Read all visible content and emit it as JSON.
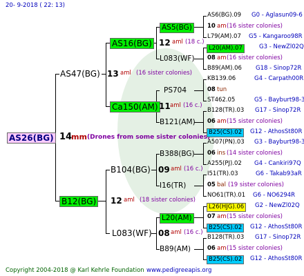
{
  "date_line": "20-  9-2018 ( 22: 13)",
  "copyright": "Copyright 2004-2018 @ Karl Kehrle Foundation",
  "website": "www.pedigreeapis.org",
  "colors": {
    "green_bg": "#00ee00",
    "yellow_bg": "#ffff00",
    "cyan_bg": "#00ccff",
    "pink_bg": "#ffccff",
    "line": "#000000"
  },
  "root": {
    "label": "AS26(BG)",
    "num": "14",
    "unit": "mm",
    "note": "(Drones from some sister colonies)"
  },
  "gen1": [
    {
      "label": "AS47(BG)",
      "num": "13",
      "unit": "aml",
      "note": "(16 sister colonies)"
    },
    {
      "label": "B12(BG)",
      "num": "12",
      "unit": "aml",
      "note": "(18 sister colonies)"
    }
  ],
  "gen2": [
    {
      "label": "AS16(BG)",
      "num": "12",
      "unit": "aml",
      "note": "(18 c.)"
    },
    {
      "label": "Ca150(AM)",
      "num": "11",
      "unit": "aml",
      "note": "(16 c.)"
    },
    {
      "label": "B104(BG)",
      "num": "09",
      "unit": "aml",
      "note": "(16 c.)"
    },
    {
      "label": "L083(WF)",
      "num": "08",
      "unit": "aml",
      "note": "(16 c.)"
    }
  ],
  "gen3": [
    "AS5(BG)",
    "L083(WF)",
    "PS704",
    "B121(AM)",
    "B388(BG)",
    "I16(TR)",
    "L20(AM)",
    "B89(AM)"
  ],
  "gen4": [
    {
      "parent": "AS6(BG).09",
      "g": "G0",
      "origin": "Aglasun09-6",
      "num": "10",
      "unit": "am",
      "note": "(16 sister colonies)",
      "mother": "L79(AM).07",
      "mg": "G5",
      "morigin": "Kangaroo98R"
    },
    {
      "parent": "L20(AM).07",
      "g": "G3",
      "origin": "NewZl02Q",
      "num": "08",
      "unit": "am",
      "note": "(16 sister colonies)",
      "mother": "B89(AM).06",
      "mg": "G18",
      "morigin": "Sinop72R"
    },
    {
      "parent": "KB139.06",
      "g": "G4",
      "origin": "Carpath00R",
      "num": "08",
      "unit": "tun",
      "note": "",
      "mother": "ST462.05",
      "mg": "G5",
      "morigin": "Bayburt98-3"
    },
    {
      "parent": "B128(TR).03",
      "g": "G17",
      "origin": "Sinop72R",
      "num": "06",
      "unit": "am",
      "note": "(15 sister colonies)",
      "mother": "B25(CS).02",
      "mg": "G12",
      "morigin": "AthosSt80R"
    },
    {
      "parent": "A507(PN).03",
      "g": "G3",
      "origin": "Bayburt98-3",
      "num": "06",
      "unit": "ins",
      "note": "(14 sister colonies)",
      "mother": "A255(PJ).02",
      "mg": "G4",
      "morigin": "Cankiri97Q"
    },
    {
      "parent": "I51(TR).03",
      "g": "G6",
      "origin": "Takab93aR",
      "num": "05",
      "unit": "bal",
      "note": "(19 sister colonies)",
      "mother": "NO61(TR).01",
      "mg": "G6",
      "morigin": "NO6294R"
    },
    {
      "parent": "L26(HJG).06",
      "g": "G2",
      "origin": "NewZl02Q",
      "num": "07",
      "unit": "am",
      "note": "(15 sister colonies)",
      "mother": "B25(CS).02",
      "mg": "G12",
      "morigin": "AthosSt80R"
    },
    {
      "parent": "B128(TR).03",
      "g": "G17",
      "origin": "Sinop72R",
      "num": "06",
      "unit": "am",
      "note": "(15 sister colonies)",
      "mother": "B25(CS).02",
      "mg": "G12",
      "morigin": "AthosSt80R"
    }
  ]
}
